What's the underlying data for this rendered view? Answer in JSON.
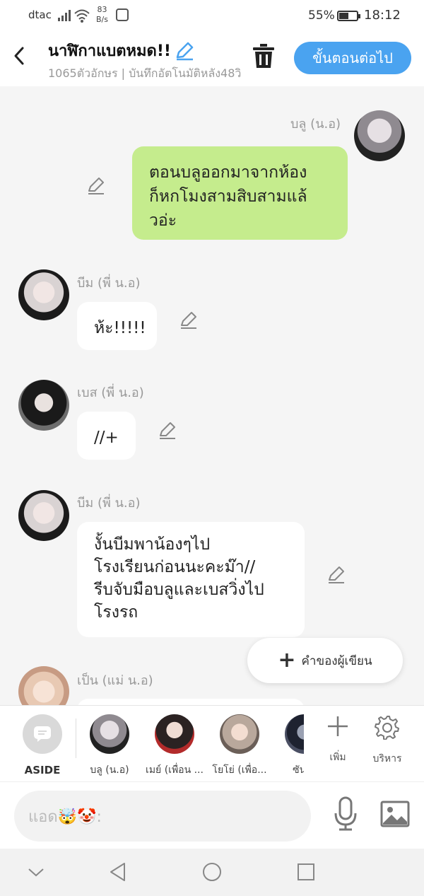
{
  "status": {
    "carrier": "dtac",
    "speed_value": "83",
    "speed_unit": "B/s",
    "battery_pct": "55%",
    "battery_level": 0.55,
    "time": "18:12"
  },
  "header": {
    "title": "นาฬิกาแบตหมด!!",
    "subtitle": "1065ตัวอักษร | บันทึกอัตโนมัติหลัง48วิ",
    "next_label": "ขั้นตอนต่อไป"
  },
  "messages": [
    {
      "sender": "บลู (น.อ)",
      "text_lines": [
        "ตอนบลูออกมาจากห้อง",
        "ก็หกโมงสามสิบสามแล้",
        "วอ่ะ"
      ],
      "mine": true
    },
    {
      "sender": "บีม (พี่ น.อ)",
      "text_lines": [
        "ห้ะ!!!!!"
      ],
      "mine": false
    },
    {
      "sender": "เบส (พี่ น.อ)",
      "text_lines": [
        "//+"
      ],
      "mine": false
    },
    {
      "sender": "บีม (พี่ น.อ)",
      "text_lines": [
        "งั้นบีมพาน้องๆไป",
        "โรงเรียนก่อนนะคะม๊า//",
        "รีบจับมือบลูและเบสวิ่งไป",
        "โรงรถ"
      ],
      "mine": false
    },
    {
      "sender": "เป็น (แม่ น.อ)",
      "text_lines": [],
      "mine": false
    }
  ],
  "fab": {
    "label": "คำของผู้เขียน"
  },
  "charbar": {
    "aside_label": "ASIDE",
    "characters": [
      {
        "name": "บลู (น.อ)"
      },
      {
        "name": "เมย์ (เพื่อน ..."
      },
      {
        "name": "โยโย่ (เพื่อ..."
      },
      {
        "name": "ซัน (เ"
      }
    ],
    "add_label": "เพิ่ม",
    "manage_label": "บริหาร"
  },
  "input": {
    "placeholder": "แอด🤯🤡:"
  },
  "colors": {
    "accent": "#4aa3f0",
    "my_bubble": "#c5ec8d",
    "other_bubble": "#ffffff",
    "chat_bg": "#f5f5f5"
  }
}
